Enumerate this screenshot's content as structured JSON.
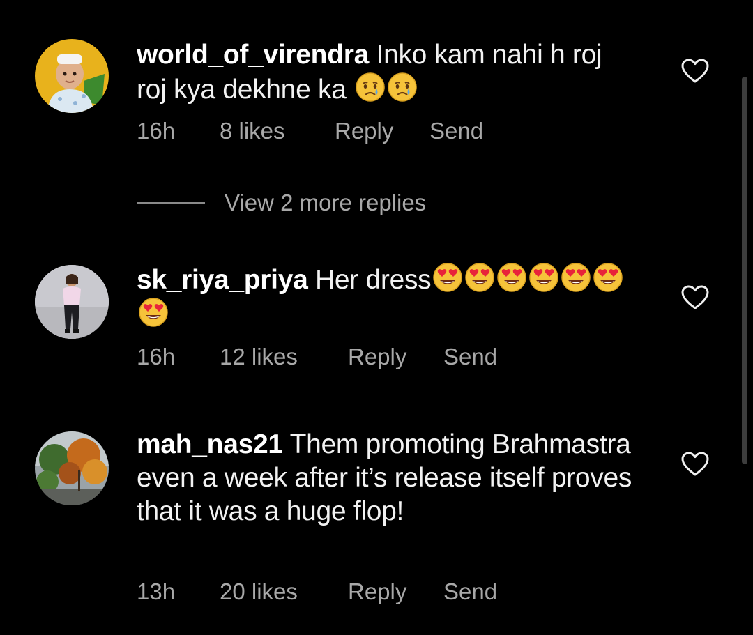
{
  "colors": {
    "background": "#000000",
    "text": "#f2f2f2",
    "secondary_text": "#a8a8a8",
    "scrollbar": "#3d3d3d"
  },
  "comments": [
    {
      "username": "world_of_virendra",
      "text": "Inko kam nahi h roj roj kya dekhne ka",
      "emojis": [
        "crying-face",
        "crying-face"
      ],
      "time": "16h",
      "likes": "8 likes",
      "reply_label": "Reply",
      "send_label": "Send",
      "like_icon": "heart-outline"
    },
    {
      "username": "sk_riya_priya",
      "text": "Her dress",
      "emojis": [
        "heart-eyes-face",
        "heart-eyes-face",
        "heart-eyes-face",
        "heart-eyes-face",
        "heart-eyes-face",
        "heart-eyes-face",
        "heart-eyes-face"
      ],
      "time": "16h",
      "likes": "12 likes",
      "reply_label": "Reply",
      "send_label": "Send",
      "like_icon": "heart-outline"
    },
    {
      "username": "mah_nas21",
      "text": "Them promoting Brahmastra even a week after it’s release itself proves that it was a huge flop!",
      "time": "13h",
      "likes": "20 likes",
      "reply_label": "Reply",
      "send_label": "Send",
      "like_icon": "heart-outline"
    }
  ],
  "view_replies": {
    "label": "View 2 more replies"
  }
}
